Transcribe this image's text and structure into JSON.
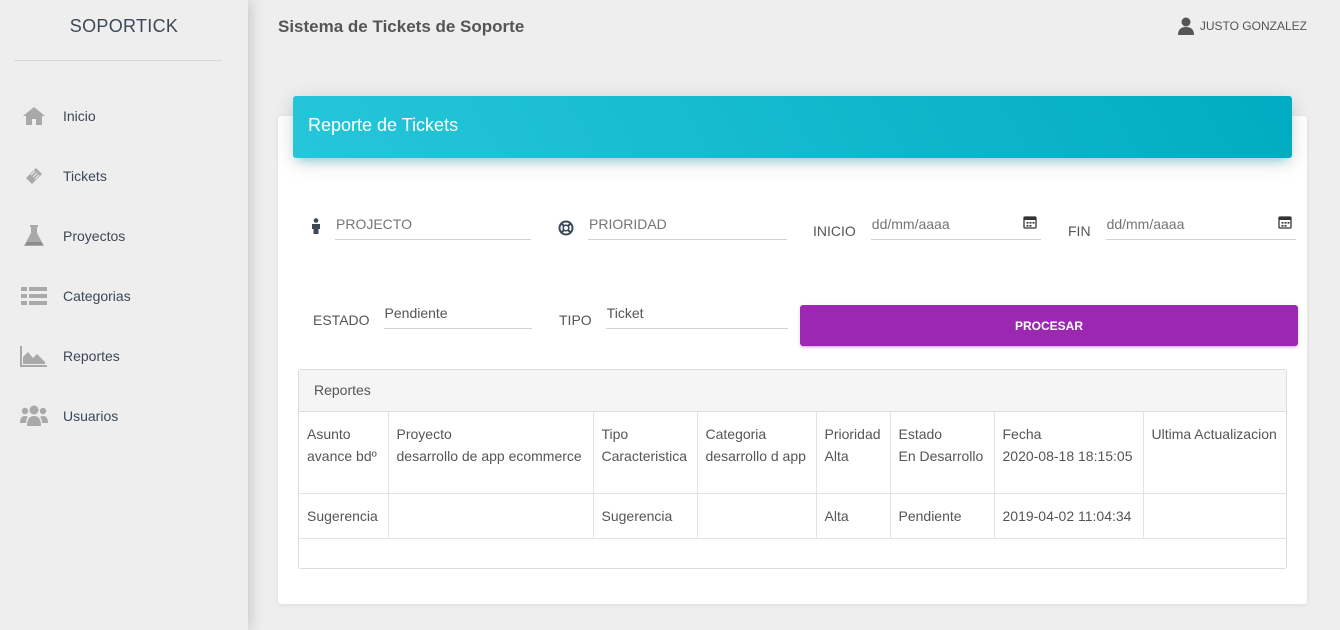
{
  "brand": "SOPORTICK",
  "sidebar": {
    "items": [
      {
        "label": "Inicio",
        "icon": "home-icon"
      },
      {
        "label": "Tickets",
        "icon": "ticket-icon"
      },
      {
        "label": "Proyectos",
        "icon": "flask-icon"
      },
      {
        "label": "Categorias",
        "icon": "list-icon"
      },
      {
        "label": "Reportes",
        "icon": "area-chart-icon"
      },
      {
        "label": "Usuarios",
        "icon": "users-icon"
      }
    ]
  },
  "header": {
    "title": "Sistema de Tickets de Soporte",
    "user": "JUSTO GONZALEZ"
  },
  "card": {
    "title": "Reporte de Tickets"
  },
  "form": {
    "proyecto_placeholder": "PROJECTO",
    "prioridad_placeholder": "PRIORIDAD",
    "inicio_label": "INICIO",
    "inicio_placeholder": "dd/mm/aaaa",
    "fin_label": "FIN",
    "fin_placeholder": "dd/mm/aaaa",
    "estado_label": "ESTADO",
    "estado_value": "Pendiente",
    "tipo_label": "TIPO",
    "tipo_value": "Ticket",
    "submit_label": "PROCESAR"
  },
  "report": {
    "title": "Reportes",
    "rows": [
      {
        "col1": [
          "Asunto",
          "avance bdº"
        ],
        "col2": [
          "Proyecto",
          "desarrollo de app ecommerce"
        ],
        "col3": [
          "Tipo",
          "Caracteristica"
        ],
        "col4": [
          "Categoria",
          "desarrollo d app"
        ],
        "col5": [
          "Prioridad",
          "Alta"
        ],
        "col6": [
          "Estado",
          "En Desarrollo"
        ],
        "col7": [
          "Fecha",
          "2020-08-18 18:15:05"
        ],
        "col8": [
          "Ultima Actualizacion",
          ""
        ]
      },
      {
        "col1": "Sugerencia",
        "col2": "",
        "col3": "Sugerencia",
        "col4": "",
        "col5": "Alta",
        "col6": "Pendiente",
        "col7": "2019-04-02 11:04:34",
        "col8": ""
      }
    ]
  },
  "colors": {
    "header_gradient_start": "#26c6da",
    "header_gradient_end": "#00acc1",
    "button": "#9c27b0",
    "background": "#eeeeee"
  }
}
